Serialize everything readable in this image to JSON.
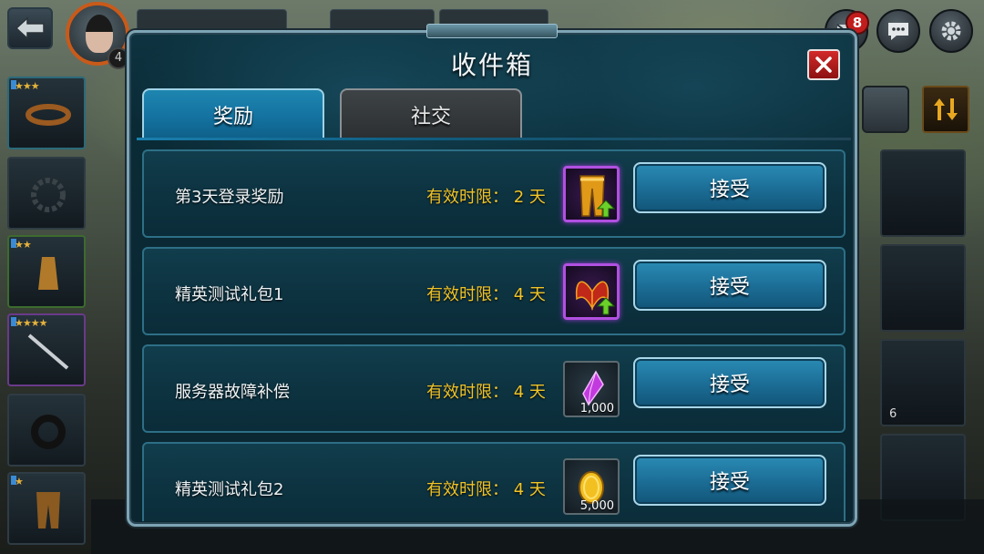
{
  "header": {
    "player_level": "4",
    "mail_count": "8"
  },
  "inventory": {
    "right_slot_count": "6"
  },
  "modal": {
    "title": "收件箱",
    "tabs": [
      {
        "label": "奖励",
        "active": true
      },
      {
        "label": "社交",
        "active": false
      }
    ],
    "rows": [
      {
        "title": "第3天登录奖励",
        "expiry_label": "有效时限：",
        "expiry_value": "2 天",
        "reward": "golden-leggings-icon",
        "reward_qty": "",
        "upgrade": true,
        "accept_label": "接受"
      },
      {
        "title": "精英测试礼包1",
        "expiry_label": "有效时限：",
        "expiry_value": "4 天",
        "reward": "red-wings-icon",
        "reward_qty": "",
        "upgrade": true,
        "accept_label": "接受"
      },
      {
        "title": "服务器故障补偿",
        "expiry_label": "有效时限：",
        "expiry_value": "4 天",
        "reward": "purple-crystal-icon",
        "reward_qty": "1,000",
        "upgrade": false,
        "accept_label": "接受"
      },
      {
        "title": "精英测试礼包2",
        "expiry_label": "有效时限：",
        "expiry_value": "4 天",
        "reward": "gold-coin-icon",
        "reward_qty": "5,000",
        "upgrade": false,
        "accept_label": "接受"
      }
    ]
  },
  "colors": {
    "accent_blue": "#1c6f98",
    "expiry_yellow": "#f0c428",
    "close_red": "#d22a2a",
    "epic_purple": "#b150e0"
  }
}
